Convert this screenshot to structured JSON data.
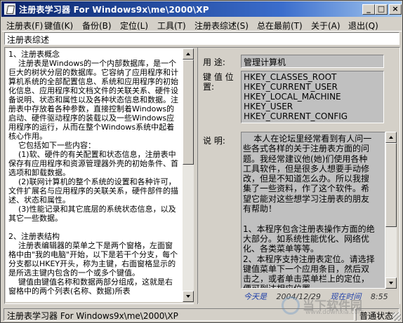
{
  "window": {
    "title": "注册表学习器 For Windows9x\\me\\2000\\XP",
    "minimize_glyph": "_",
    "maximize_glyph": "□",
    "close_glyph": "×"
  },
  "menu": [
    {
      "label": "注册表(F)"
    },
    {
      "label": "键值(K)"
    },
    {
      "label": "备份(B)"
    },
    {
      "label": "定位(L)"
    },
    {
      "label": "工具(T)"
    },
    {
      "label": "注册表综述(S)"
    },
    {
      "label": "总在最前(T)"
    },
    {
      "label": "关于(A)"
    },
    {
      "label": "退出(Q)"
    }
  ],
  "header_field": {
    "value": "注册表综述"
  },
  "left_pane": {
    "text": "1、注册表概念\n    注册表是Windows的一个内部数据库，是一个巨大的树状分层的数据库。它容纳了应用程序和计算机系统的全部配置信息、系统和应用程序的初始化信息、应用程序和文档文件的关联关系、硬件设备说明、状态和属性以及各种状态信息和数据。注册表中存放着各种参数，直接控制着Windows的启动、硬件驱动程序的装载以及一些Windows应用程序的运行，从而在整个Windows系统中起着核心作用。\n    它包括如下一些内容：\n    (1)软、硬件的有关配置和状态信息，注册表中保存有应用程序和资源管理器外壳的初始条件、首选项和卸载数据。\n    (2)联网计算机的整个系统的设置和各种许可，文件扩展名与应用程序的关联关系，硬件部件的描述、状态和属性。\n    (3)性能记录和其它底层的系统状态信息，以及其它一些数据。\n\n2、注册表结构\n    注册表编辑器的菜单之下是两个窗格，左面窗格中由\"我的电脑\"开始，以下是若干个分支，每个分支都以HKEY开头，称为主键，右面窗格显示的是所选主键内包含的一个或多个键值。\n    键值由键值名称和数据两部分组成，这就是右窗格中的两个列表(名称、数据)所表"
  },
  "right_pane": {
    "usage_label": "用  途:",
    "usage_value": "管理计算机",
    "reg_label": "键 值 位 置:",
    "reg_keys": [
      "HKEY_CLASSES_ROOT",
      "HKEY_CURRENT_USER",
      "HKEY_LOCAL_MACHINE",
      "HKEY_USER",
      "HKEY_CURRENT_CONFIG"
    ],
    "desc_label": "说  明:",
    "desc_text": "    本人在论坛里经常看到有人问一些各式各样的关于注册表方面的问题。我经常建议他(她)们使用各种工具软件，但是很多人想要手动修改，但是不知道怎么办。所以我搜集了一些资料，作了这个软件。希望它能对这些想学习注册表的朋友有帮助！\n\n1、本程序包含注册表操作方面的绝大部分。如系统性能优化、网络优化、各类菜单等等。\n2、本程序支持注册表定位。请选择键值菜单下一个应用条目，然后双击之，或者单击菜单栏上的定位，便可到达相应位置。\n3、本程序支持窗体最前端。可以将窗",
    "footer_author": "今天是",
    "footer_date": "2004/12/29",
    "footer_now_label": "现在时间",
    "footer_time": "8:55"
  },
  "watermark": {
    "text": "当下软件园",
    "sub": "www.downxia.com"
  },
  "status": {
    "main": "注册表学习器 For Windows9x\\me\\2000\\XP",
    "state": "普通状态"
  }
}
